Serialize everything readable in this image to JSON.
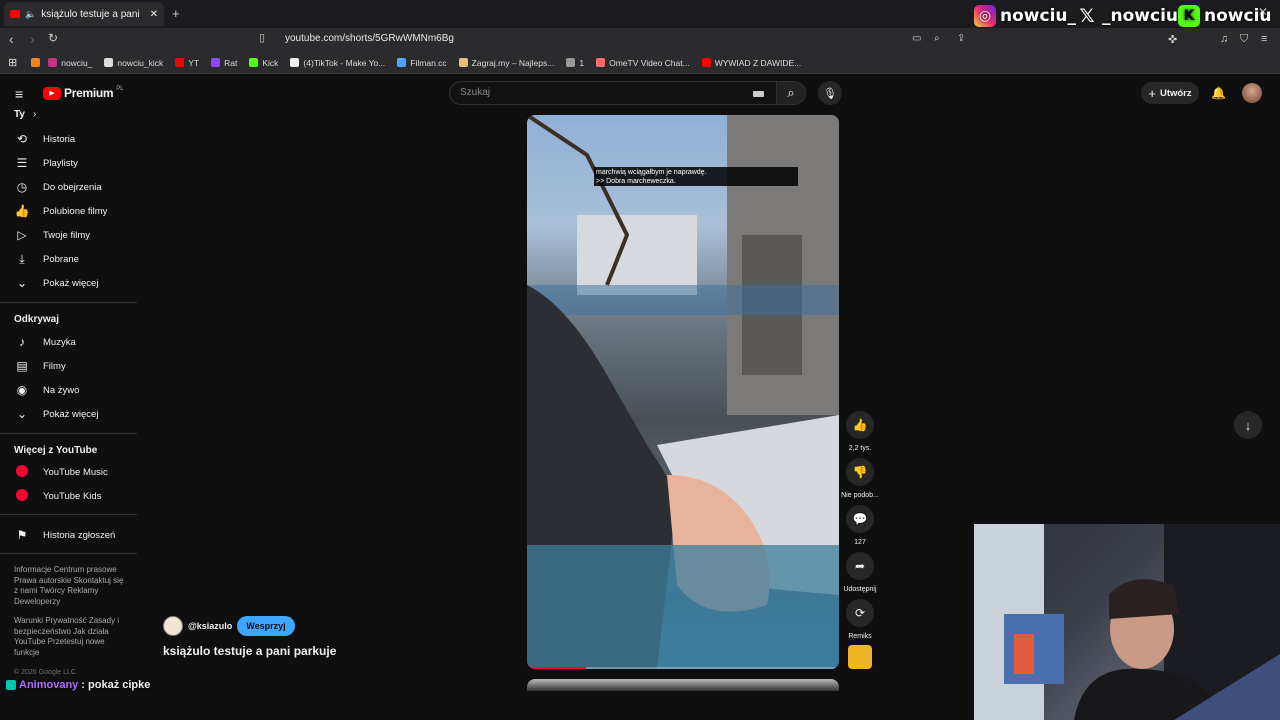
{
  "browser": {
    "tab_title": "książulo testuje a pani parku",
    "url": "youtube.com/shorts/5GRwWMNm6Bg",
    "bookmarks": [
      {
        "label": "nowciu_",
        "color": "#c13584"
      },
      {
        "label": "nowciu_kick",
        "color": "#dddddd"
      },
      {
        "label": "YT",
        "color": "#ff0000"
      },
      {
        "label": "Rat",
        "color": "#9146ff"
      },
      {
        "label": "Kick",
        "color": "#53fc18"
      },
      {
        "label": "(4)TikTok - Make Yo...",
        "color": "#eeeeee"
      },
      {
        "label": "Filman.cc",
        "color": "#4da3ff"
      },
      {
        "label": "Zagraj.my – Najleps...",
        "color": "#e5c07b"
      },
      {
        "label": "1",
        "color": "#999999"
      },
      {
        "label": "OmeTV Video Chat...",
        "color": "#ff6b6b"
      },
      {
        "label": "WYWIAD Z DAWIDE...",
        "color": "#ff0000"
      }
    ]
  },
  "overlay": {
    "instagram": "nowciu_",
    "x": "_nowciu",
    "kick": "nowciu",
    "chat_user": "Animovany",
    "chat_message": ": pokaż cipke"
  },
  "youtube": {
    "logo_text": "Premium",
    "logo_region": "PL",
    "search_placeholder": "Szukaj",
    "create_label": "Utwórz"
  },
  "sidebar": {
    "you_label": "Ty",
    "you_items": [
      {
        "label": "Historia",
        "icon": "history-icon",
        "glyph": "⟲"
      },
      {
        "label": "Playlisty",
        "icon": "playlist-icon",
        "glyph": "☰"
      },
      {
        "label": "Do obejrzenia",
        "icon": "watch-later-icon",
        "glyph": "◷"
      },
      {
        "label": "Polubione filmy",
        "icon": "like-icon",
        "glyph": "👍"
      },
      {
        "label": "Twoje filmy",
        "icon": "your-videos-icon",
        "glyph": "▷"
      },
      {
        "label": "Pobrane",
        "icon": "download-icon",
        "glyph": "⤓"
      },
      {
        "label": "Pokaż więcej",
        "icon": "chevron-down-icon",
        "glyph": "⌄"
      }
    ],
    "explore_label": "Odkrywaj",
    "explore_items": [
      {
        "label": "Muzyka",
        "icon": "music-icon",
        "glyph": "♪"
      },
      {
        "label": "Filmy",
        "icon": "film-icon",
        "glyph": "▤"
      },
      {
        "label": "Na żywo",
        "icon": "live-icon",
        "glyph": "◉"
      },
      {
        "label": "Pokaż więcej",
        "icon": "chevron-down-icon",
        "glyph": "⌄"
      }
    ],
    "more_label": "Więcej z YouTube",
    "more_items": [
      {
        "label": "YouTube Music",
        "icon": "youtube-music-icon"
      },
      {
        "label": "YouTube Kids",
        "icon": "youtube-kids-icon"
      }
    ],
    "report_label": "Historia zgłoszeń",
    "footer_1": "Informacje  Centrum prasowe  Prawa autorskie  Skontaktuj się z nami  Twórcy  Reklamy  Deweloperzy",
    "footer_2": "Warunki  Prywatność  Zasady i bezpieczeństwo  Jak działa YouTube  Przetestuj nowe funkcje",
    "copyright": "© 2026 Google LLC"
  },
  "short": {
    "caption_line1": "marchwią wciągałbym je naprawdę.",
    "caption_line2": ">> Dobra marcheweczka.",
    "channel": "@ksiazulo",
    "support_label": "Wesprzyj",
    "title": "książulo testuje a pani parkuje",
    "likes": "2,2 tys.",
    "dislike_label": "Nie podob...",
    "comments": "127",
    "share_label": "Udostępnij",
    "remix_label": "Remiks",
    "progress": 0.19
  }
}
